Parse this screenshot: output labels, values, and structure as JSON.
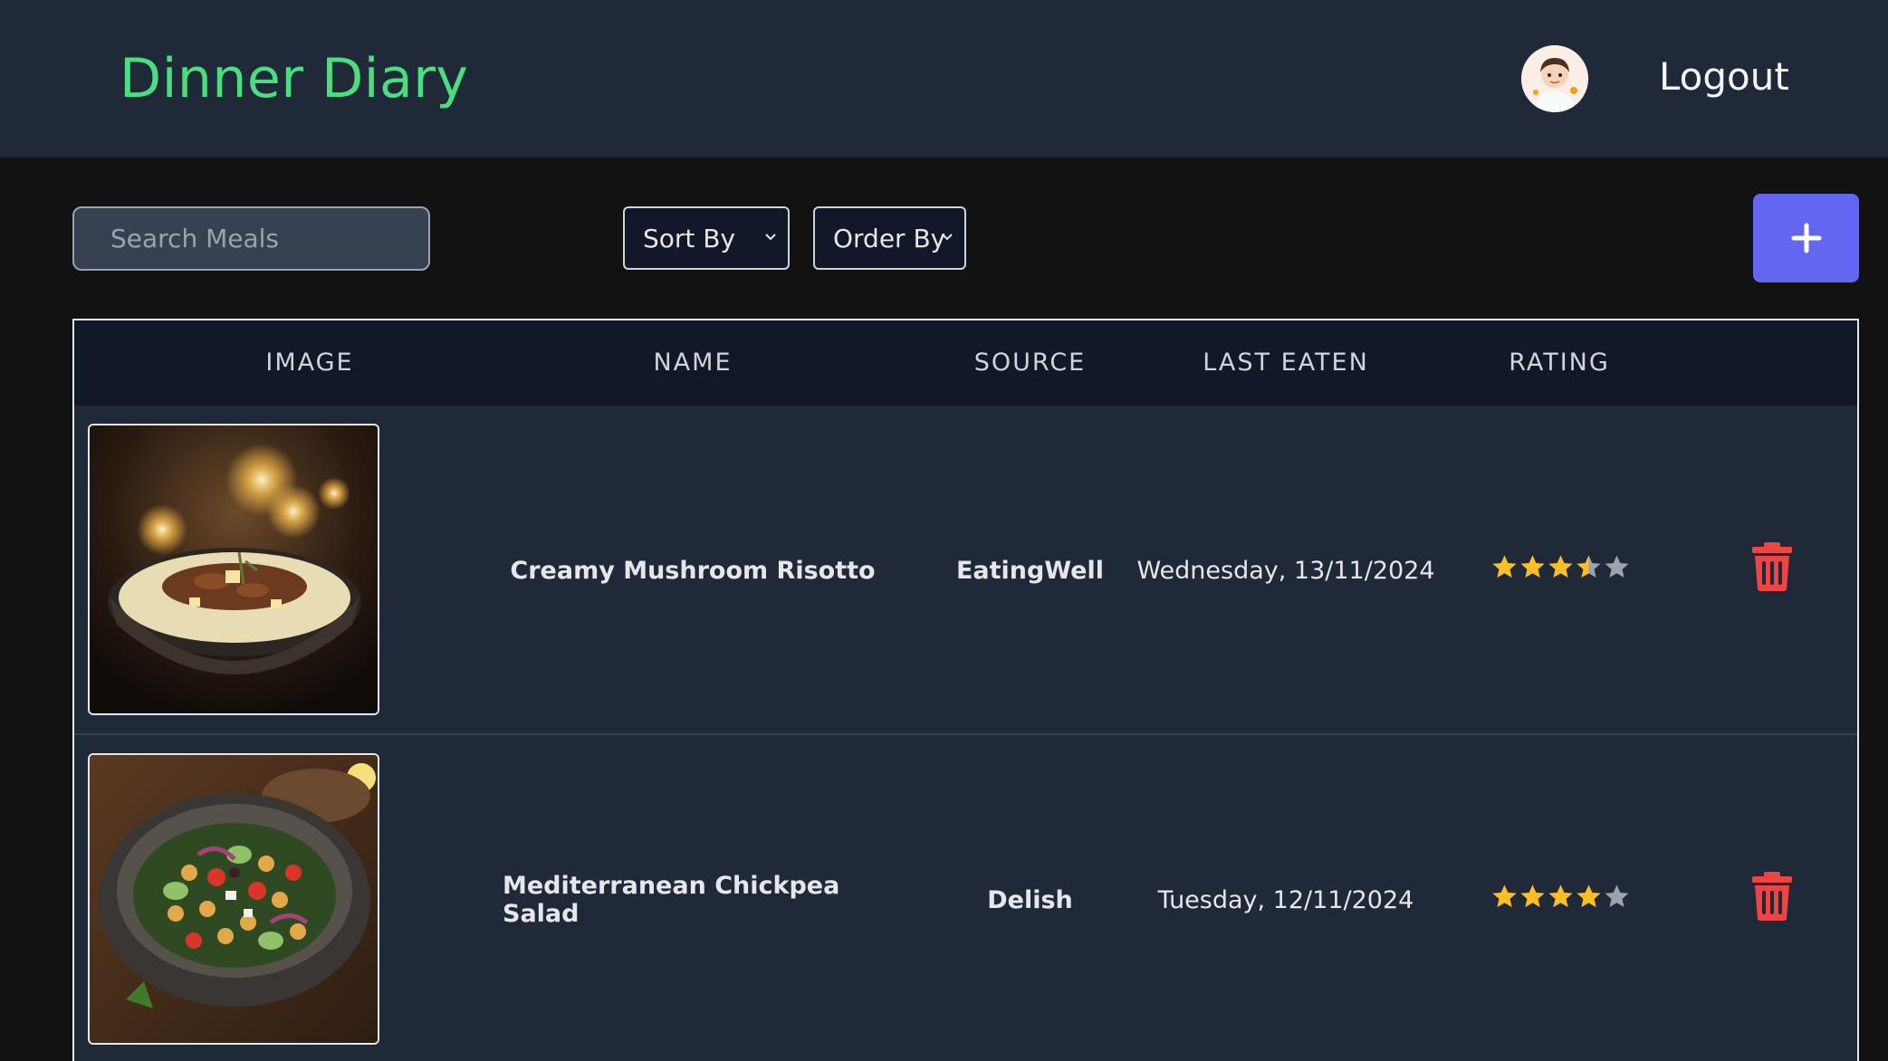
{
  "header": {
    "title": "Dinner Diary",
    "logout_label": "Logout",
    "avatar_icon": "chef-avatar"
  },
  "toolbar": {
    "search_placeholder": "Search Meals",
    "sort_label": "Sort By",
    "order_label": "Order By",
    "add_icon": "plus-icon"
  },
  "table": {
    "columns": [
      "IMAGE",
      "NAME",
      "SOURCE",
      "LAST EATEN",
      "RATING"
    ],
    "rows": [
      {
        "name": "Creamy Mushroom Risotto",
        "source": "EatingWell",
        "last_eaten": "Wednesday, 13/11/2024",
        "rating": 3.5,
        "image_icon": "risotto-photo"
      },
      {
        "name": "Mediterranean Chickpea Salad",
        "source": "Delish",
        "last_eaten": "Tuesday, 12/11/2024",
        "rating": 4,
        "image_icon": "chickpea-salad-photo"
      }
    ]
  },
  "colors": {
    "brand": "#4ade80",
    "accent": "#6366f1",
    "star_filled": "#fbbf24",
    "star_empty": "#9ca3af",
    "danger": "#ef4444"
  }
}
